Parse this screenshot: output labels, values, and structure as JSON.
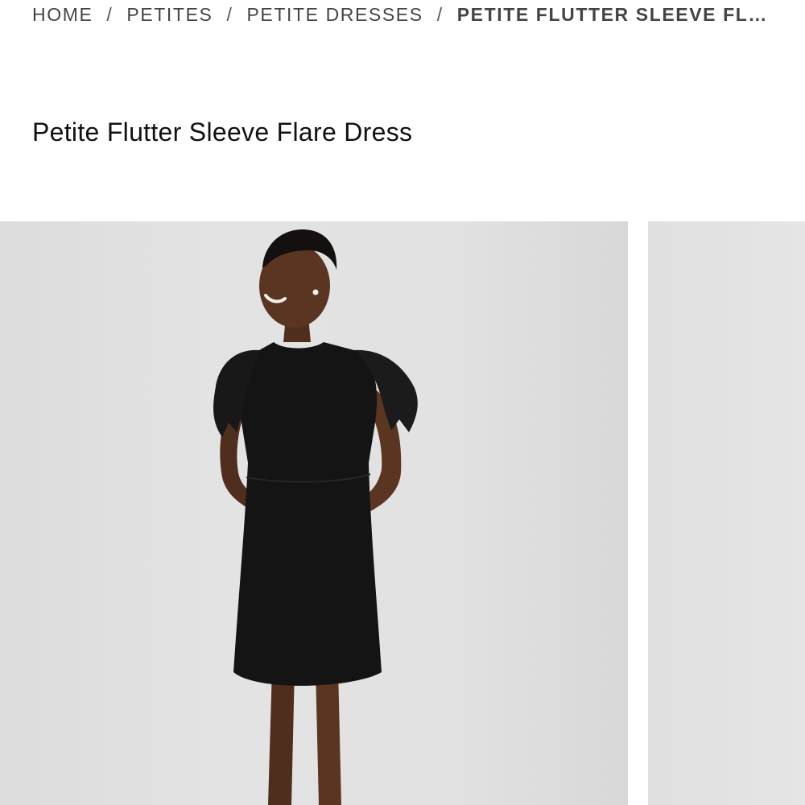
{
  "breadcrumb": {
    "items": [
      {
        "label": "HOME"
      },
      {
        "label": "PETITES"
      },
      {
        "label": "PETITE DRESSES"
      }
    ],
    "separator": "/",
    "current": "PETITE FLUTTER SLEEVE FLA..."
  },
  "product": {
    "title": "Petite Flutter Sleeve Flare Dress"
  },
  "gallery": {
    "main_image": "model-black-dress-image",
    "next_image": "next-product-image-partial"
  },
  "colors": {
    "text": "#444444",
    "title": "#111111",
    "image_background": "#e2e2e2",
    "dress": "#141414",
    "skin": "#5a3522"
  }
}
